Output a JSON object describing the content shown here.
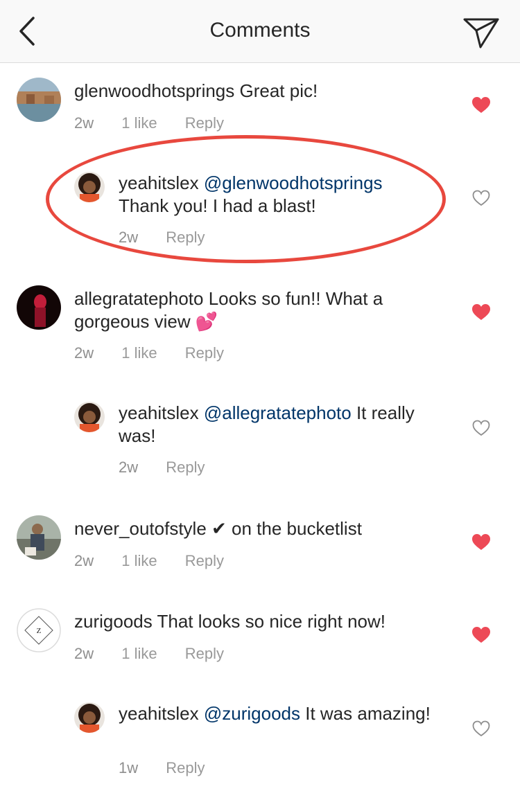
{
  "header": {
    "title": "Comments",
    "back_icon": "chevron-left-icon",
    "send_icon": "paper-plane-icon"
  },
  "colors": {
    "heart_liked": "#ed4956",
    "mention": "#003569",
    "meta": "#8e8e8e",
    "highlight": "#e8483e"
  },
  "comments": [
    {
      "username": "glenwoodhotsprings",
      "text": " Great pic!",
      "time": "2w",
      "likes": "1 like",
      "reply_label": "Reply",
      "liked": true,
      "replies": [
        {
          "username": "yeahitslex",
          "mention": "@glenwoodhotsprings",
          "text": "Thank you! I had a blast!",
          "time": "2w",
          "reply_label": "Reply",
          "liked": false
        }
      ]
    },
    {
      "username": "allegratatephoto",
      "text": " Looks so fun!! What a gorgeous view 💕",
      "time": "2w",
      "likes": "1 like",
      "reply_label": "Reply",
      "liked": true,
      "replies": [
        {
          "username": "yeahitslex",
          "mention": "@allegratatephoto",
          "text": " It really was!",
          "time": "2w",
          "reply_label": "Reply",
          "liked": false
        }
      ]
    },
    {
      "username": "never_outofstyle",
      "text": " ✔︎  on the bucketlist",
      "time": "2w",
      "likes": "1 like",
      "reply_label": "Reply",
      "liked": true,
      "replies": []
    },
    {
      "username": "zurigoods",
      "text": " That looks so nice right now!",
      "time": "2w",
      "likes": "1 like",
      "reply_label": "Reply",
      "liked": true,
      "replies": [
        {
          "username": "yeahitslex",
          "mention": "@zurigoods",
          "text": " It was amazing!",
          "time": "1w",
          "reply_label": "Reply",
          "liked": false
        }
      ]
    }
  ]
}
